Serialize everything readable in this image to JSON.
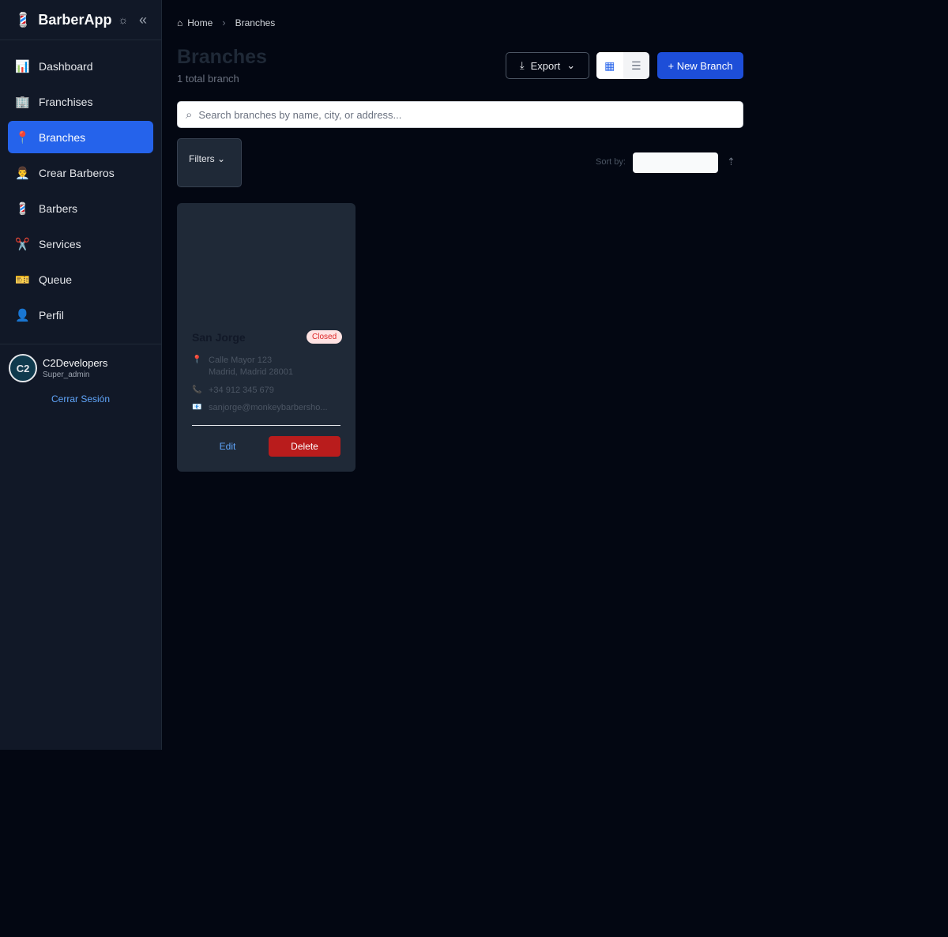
{
  "app": {
    "title": "BarberApp",
    "logo_icon": "💈",
    "theme_icon": "☼",
    "collapse_icon": "«"
  },
  "sidebar": {
    "items": [
      {
        "icon": "📊",
        "label": "Dashboard"
      },
      {
        "icon": "🏢",
        "label": "Franchises"
      },
      {
        "icon": "📍",
        "label": "Branches",
        "active": true
      },
      {
        "icon": "👨‍💼",
        "label": "Crear Barberos"
      },
      {
        "icon": "💈",
        "label": "Barbers"
      },
      {
        "icon": "✂️",
        "label": "Services"
      },
      {
        "icon": "🎫",
        "label": "Queue"
      },
      {
        "icon": "👤",
        "label": "Perfil"
      }
    ]
  },
  "user": {
    "avatar_text": "C2",
    "name": "C2Developers",
    "role": "Super_admin",
    "logout_label": "Cerrar Sesión"
  },
  "breadcrumb": {
    "home": "Home",
    "current": "Branches"
  },
  "page": {
    "title": "Branches",
    "count": "1 total branch"
  },
  "toolbar": {
    "export_label": "Export",
    "new_label": "+ New Branch"
  },
  "search": {
    "placeholder": "Search branches by name, city, or address..."
  },
  "filters": {
    "label": "Filters"
  },
  "sort": {
    "label": "Sort by:"
  },
  "branches": [
    {
      "name": "San Jorge",
      "status": "Closed",
      "address_line1": "Calle Mayor 123",
      "address_line2": "Madrid, Madrid 28001",
      "phone": "+34 912 345 679",
      "email": "sanjorge@monkeybarbersho...",
      "edit_label": "Edit",
      "delete_label": "Delete"
    }
  ],
  "colors": {
    "accent": "#2563eb",
    "primary_button": "#1d4ed8",
    "danger": "#b91c1c",
    "closed_badge_bg": "#fee2e2",
    "closed_badge_text": "#dc2626"
  }
}
